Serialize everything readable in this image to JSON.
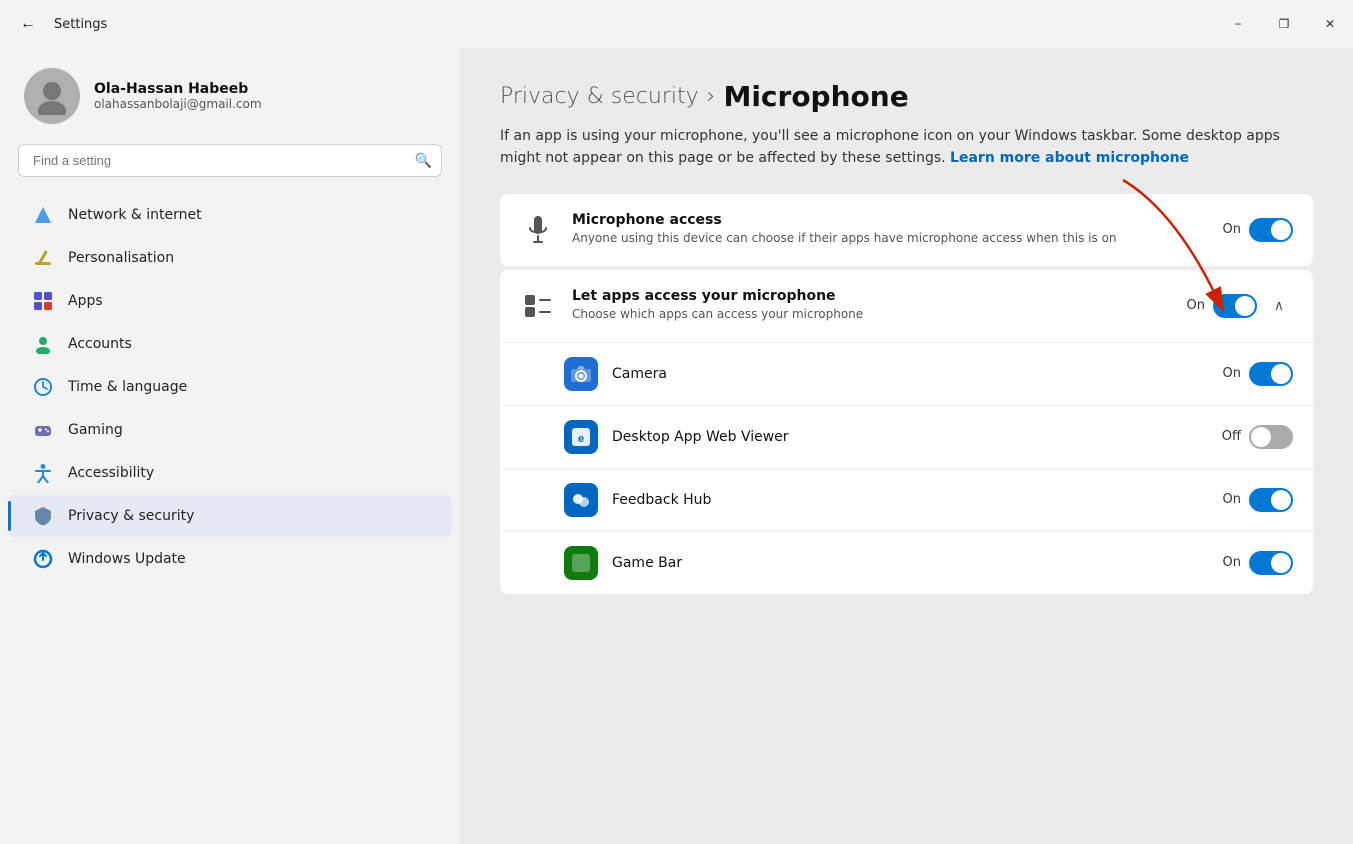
{
  "titlebar": {
    "back_label": "←",
    "title": "Settings",
    "minimize": "−",
    "maximize": "❐",
    "close": "✕"
  },
  "user": {
    "name": "Ola-Hassan Habeeb",
    "email": "olahassanbolaji@gmail.com"
  },
  "search": {
    "placeholder": "Find a setting"
  },
  "nav": {
    "items": [
      {
        "id": "network",
        "label": "Network & internet",
        "icon": "🔷"
      },
      {
        "id": "personalisation",
        "label": "Personalisation",
        "icon": "✏️"
      },
      {
        "id": "apps",
        "label": "Apps",
        "icon": "🟦"
      },
      {
        "id": "accounts",
        "label": "Accounts",
        "icon": "👤"
      },
      {
        "id": "time-language",
        "label": "Time & language",
        "icon": "🌐"
      },
      {
        "id": "gaming",
        "label": "Gaming",
        "icon": "🎮"
      },
      {
        "id": "accessibility",
        "label": "Accessibility",
        "icon": "♿"
      },
      {
        "id": "privacy-security",
        "label": "Privacy & security",
        "icon": "🔒",
        "active": true
      },
      {
        "id": "windows-update",
        "label": "Windows Update",
        "icon": "🔄"
      }
    ]
  },
  "breadcrumb": {
    "parent": "Privacy & security",
    "separator": "›",
    "current": "Microphone"
  },
  "description": {
    "text": "If an app is using your microphone, you'll see a microphone icon on your Windows taskbar. Some desktop apps might not appear on this page or be affected by these settings.",
    "learn_more": "Learn more about microphone"
  },
  "microphone_access": {
    "title": "Microphone access",
    "description": "Anyone using this device can choose if their apps have microphone access when this is on",
    "status": "On",
    "enabled": true
  },
  "let_apps": {
    "title": "Let apps access your microphone",
    "description": "Choose which apps can access your microphone",
    "status": "On",
    "enabled": true,
    "expanded": true
  },
  "apps": [
    {
      "id": "camera",
      "name": "Camera",
      "status": "On",
      "enabled": true,
      "icon_type": "camera",
      "icon": "📷"
    },
    {
      "id": "desktop-web-viewer",
      "name": "Desktop App Web Viewer",
      "status": "Off",
      "enabled": false,
      "icon_type": "web-viewer",
      "icon": "🔵"
    },
    {
      "id": "feedback-hub",
      "name": "Feedback Hub",
      "status": "On",
      "enabled": true,
      "icon_type": "feedback",
      "icon": "👥"
    },
    {
      "id": "game-bar",
      "name": "Game Bar",
      "status": "On",
      "enabled": true,
      "icon_type": "green",
      "icon": "🟢"
    }
  ],
  "colors": {
    "accent": "#0078d4",
    "active_nav": "#e5eaf2",
    "active_border": "#0078d4"
  }
}
